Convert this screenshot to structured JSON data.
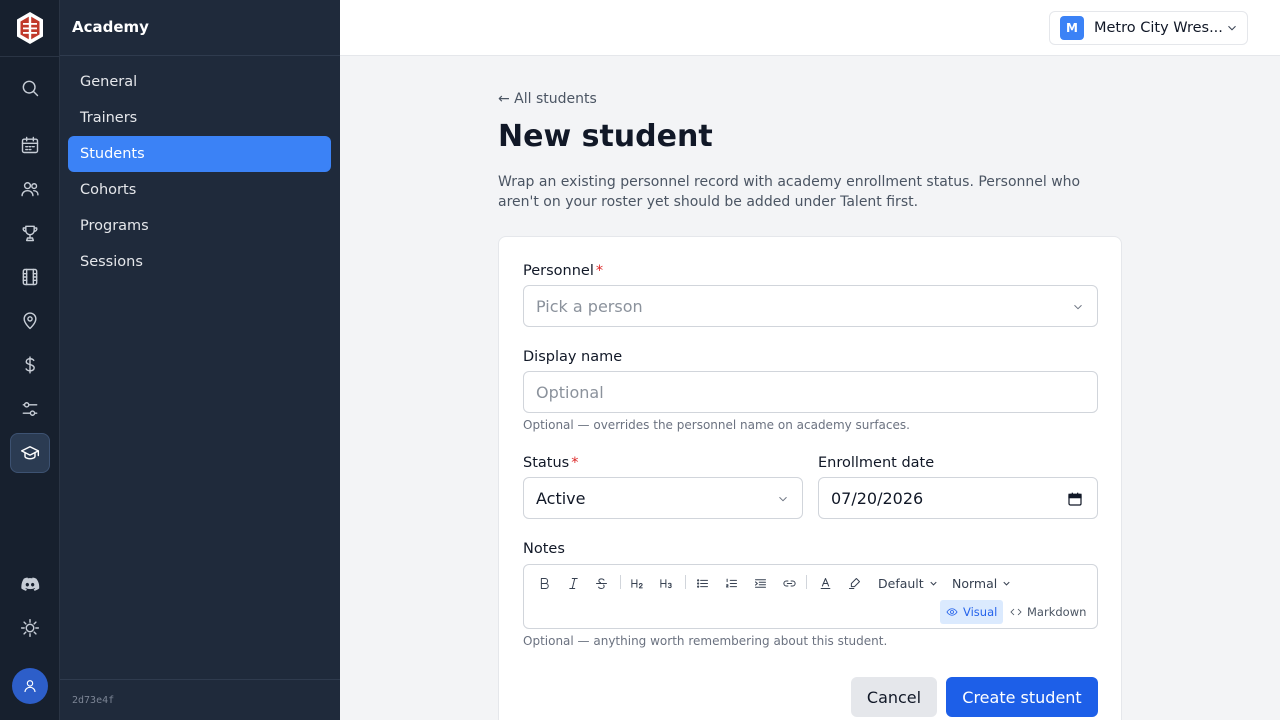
{
  "sidebar": {
    "title": "Academy",
    "items": [
      {
        "label": "General"
      },
      {
        "label": "Trainers"
      },
      {
        "label": "Students"
      },
      {
        "label": "Cohorts"
      },
      {
        "label": "Programs"
      },
      {
        "label": "Sessions"
      }
    ],
    "active_item": "Students",
    "build": "2d73e4f"
  },
  "rail": {
    "icons": [
      "logo-icon",
      "search-icon",
      "calendar-icon",
      "users-icon",
      "trophy-icon",
      "film-icon",
      "map-pin-icon",
      "dollar-icon",
      "sliders-icon",
      "graduation-cap-icon",
      "discord-icon",
      "settings-icon",
      "user-icon"
    ],
    "active_icon": "graduation-cap-icon"
  },
  "topbar": {
    "org_initial": "M",
    "org_name": "Metro City Wres..."
  },
  "page": {
    "back_link": "← All students",
    "title": "New student",
    "description": "Wrap an existing personnel record with academy enrollment status. Personnel who aren't on your roster yet should be added under Talent first."
  },
  "form": {
    "personnel": {
      "label": "Personnel",
      "required_mark": "*",
      "placeholder": "Pick a person"
    },
    "display_name": {
      "label": "Display name",
      "placeholder": "Optional",
      "hint": "Optional — overrides the personnel name on academy surfaces."
    },
    "status": {
      "label": "Status",
      "required_mark": "*",
      "value": "Active"
    },
    "enrollment_date": {
      "label": "Enrollment date",
      "value": "07/20/2026"
    },
    "notes": {
      "label": "Notes",
      "font_select": "Default",
      "size_select": "Normal",
      "mode_visual": "Visual",
      "mode_markdown": "Markdown",
      "active_mode": "Visual",
      "hint": "Optional — anything worth remembering about this student."
    },
    "cancel_label": "Cancel",
    "submit_label": "Create student"
  },
  "colors": {
    "accent": "#3b82f6",
    "primary_button": "#1d5fe8",
    "rail_bg": "#17202e",
    "sidebar_bg": "#1f2a3b",
    "required": "#dc2626"
  }
}
